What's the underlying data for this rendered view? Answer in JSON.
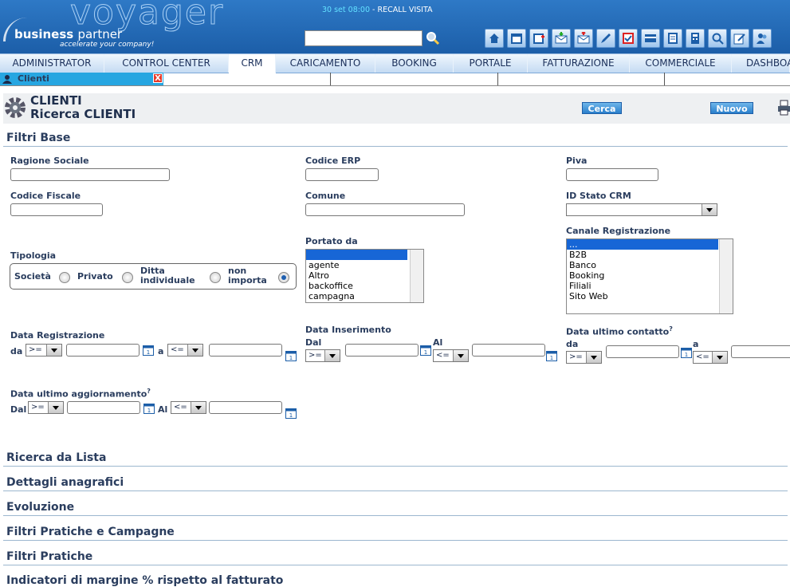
{
  "topbar": {
    "logo_voyager": "voyager",
    "logo_business": "business",
    "logo_partner": "partner",
    "logo_tagline": "accelerate your company!",
    "recall_time": "30 set 08:00",
    "recall_text": " - RECALL VISITA",
    "search_placeholder": "",
    "toolbar_icons": [
      "home-icon",
      "calendar-icon",
      "calendar-add-icon",
      "mail-in-icon",
      "mail-out-icon",
      "pencil-icon",
      "checklist-icon",
      "card-icon",
      "list-icon",
      "calculator-icon",
      "magnifier-icon",
      "edit-note-icon",
      "users-icon"
    ]
  },
  "nav": {
    "items": [
      "ADMINISTRATOR",
      "CONTROL CENTER",
      "CRM",
      "CARICAMENTO",
      "BOOKING",
      "PORTALE",
      "FATTURAZIONE",
      "COMMERCIALE",
      "DASHBOA"
    ],
    "active": "CRM"
  },
  "subbar": {
    "tab_label": "Clienti",
    "close": "X"
  },
  "header": {
    "title": "CLIENTI",
    "subtitle": "Ricerca CLIENTI",
    "search_button": "Cerca",
    "new_button": "Nuovo"
  },
  "filtri_base": {
    "heading": "Filtri Base",
    "ragione_sociale": "Ragione Sociale",
    "codice_erp": "Codice ERP",
    "piva": "Piva",
    "codice_fiscale": "Codice Fiscale",
    "comune": "Comune",
    "id_stato_crm": "ID Stato CRM",
    "portato_da": {
      "label": "Portato da",
      "options": [
        "",
        "agente",
        "Altro",
        "backoffice",
        "campagna"
      ]
    },
    "canale_registrazione": {
      "label": "Canale Registrazione",
      "options": [
        "...",
        "B2B",
        "Banco",
        "Booking",
        "Filiali",
        "Sito Web"
      ]
    },
    "tipologia": {
      "label": "Tipologia",
      "options": [
        "Società",
        "Privato",
        "Ditta individuale",
        "non importa"
      ],
      "selected": "non importa"
    },
    "data_registrazione": {
      "label": "Data Registrazione",
      "from": "da",
      "to": "a",
      "op_from": ">=",
      "op_to": "<="
    },
    "data_inserimento": {
      "label": "Data Inserimento",
      "from": "Dal",
      "to": "Al",
      "op_from": ">=",
      "op_to": "<="
    },
    "data_ultimo_contatto": {
      "label": "Data ultimo contatto",
      "sup": "?",
      "from": "da",
      "to": "a",
      "op_from": ">=",
      "op_to": "<="
    },
    "data_ultimo_aggiornamento": {
      "label": "Data ultimo aggiornamento",
      "sup": "?",
      "from": "Dal",
      "to": "Al",
      "op_from": ">=",
      "op_to": "<="
    }
  },
  "sections": [
    "Ricerca da Lista",
    "Dettagli anagrafici",
    "Evoluzione",
    "Filtri Pratiche e Campagne",
    "Filtri Pratiche",
    "Indicatori di margine % rispetto al fatturato"
  ],
  "colors": {
    "topbar": "#1c5ea8",
    "client_tab": "#27a6e1",
    "accent_button": "#2a7fcb"
  }
}
